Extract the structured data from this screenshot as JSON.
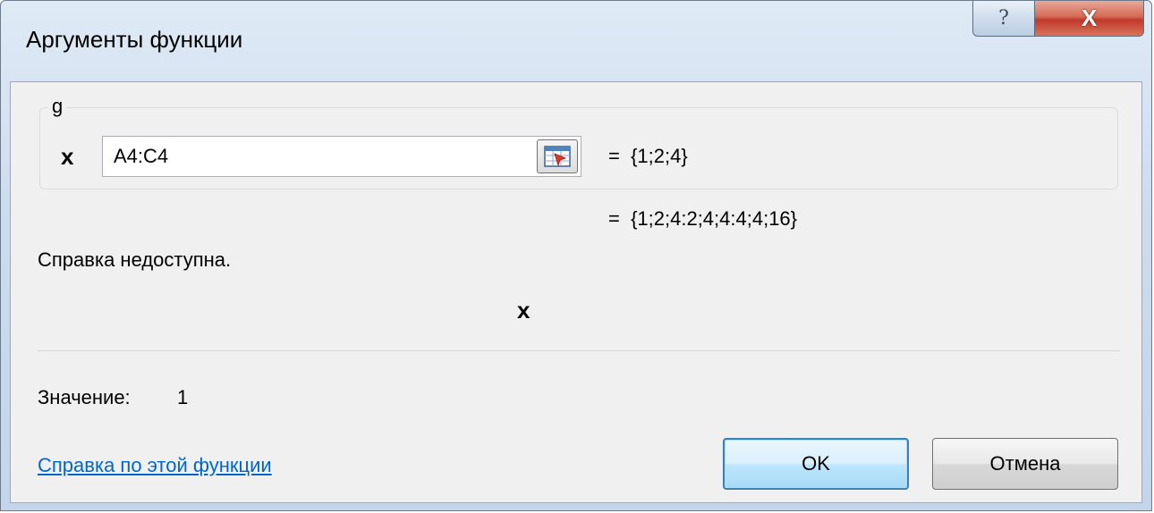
{
  "window": {
    "title": "Аргументы функции",
    "help_glyph": "?",
    "close_glyph": "X"
  },
  "group": {
    "function_name": "g",
    "argument": {
      "name": "x",
      "value": "A4:C4",
      "result": "=  {1;2;4}"
    }
  },
  "function_result": "=  {1;2;4:2;4;4:4;4;16}",
  "help_text": "Справка недоступна.",
  "current_argument": "x",
  "value": {
    "label": "Значение:",
    "number": "1"
  },
  "help_link": "Справка по этой функции",
  "buttons": {
    "ok": "OK",
    "cancel": "Отмена"
  },
  "colors": {
    "link": "#0066cc",
    "close_button": "#c0392b",
    "default_button_border": "#3c7fb1"
  }
}
